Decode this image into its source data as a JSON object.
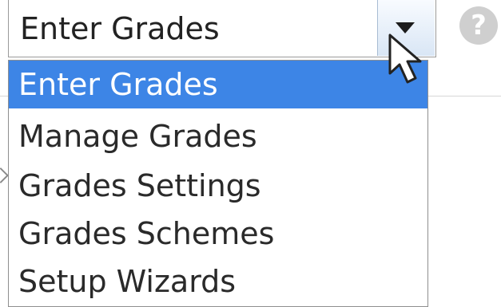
{
  "select": {
    "value": "Enter Grades",
    "button_icon": "chevron-down-icon"
  },
  "help": {
    "icon": "help-icon",
    "label": "?"
  },
  "dropdown": {
    "options": [
      {
        "label": "Enter Grades",
        "selected": true
      },
      {
        "label": "Manage Grades",
        "selected": false
      },
      {
        "label": "Grades Settings",
        "selected": false
      },
      {
        "label": "Grades Schemes",
        "selected": false
      },
      {
        "label": "Setup Wizards",
        "selected": false
      }
    ]
  },
  "colors": {
    "selected_background": "#3d85e6",
    "selected_text": "#ffffff"
  }
}
